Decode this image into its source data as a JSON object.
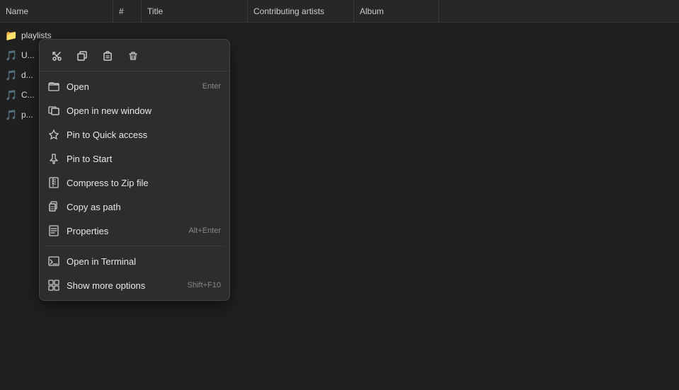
{
  "header": {
    "columns": [
      {
        "label": "Name",
        "class": "name"
      },
      {
        "label": "#",
        "class": "hash"
      },
      {
        "label": "Title",
        "class": "title"
      },
      {
        "label": "Contributing artists",
        "class": "contributing"
      },
      {
        "label": "Album",
        "class": "album"
      }
    ]
  },
  "file_list": [
    {
      "name": "playlists",
      "type": "folder"
    },
    {
      "name": "U...",
      "type": "file"
    },
    {
      "name": "d...",
      "type": "file"
    },
    {
      "name": "C...",
      "type": "file"
    },
    {
      "name": "p...",
      "type": "file"
    }
  ],
  "toolbar": {
    "cut_label": "✂",
    "copy_label": "⧉",
    "paste_label": "⬚",
    "delete_label": "🗑"
  },
  "context_menu": {
    "items": [
      {
        "id": "open",
        "label": "Open",
        "shortcut": "Enter",
        "icon": "📁"
      },
      {
        "id": "open-new-window",
        "label": "Open in new window",
        "shortcut": "",
        "icon": "⧉"
      },
      {
        "id": "pin-quick-access",
        "label": "Pin to Quick access",
        "shortcut": "",
        "icon": "☆"
      },
      {
        "id": "pin-start",
        "label": "Pin to Start",
        "shortcut": "",
        "icon": "📌"
      },
      {
        "id": "compress-zip",
        "label": "Compress to Zip file",
        "shortcut": "",
        "icon": "🗜"
      },
      {
        "id": "copy-path",
        "label": "Copy as path",
        "shortcut": "",
        "icon": "📋"
      },
      {
        "id": "properties",
        "label": "Properties",
        "shortcut": "Alt+Enter",
        "icon": "ℹ"
      },
      {
        "id": "open-terminal",
        "label": "Open in Terminal",
        "shortcut": "",
        "icon": "⊡"
      },
      {
        "id": "show-more",
        "label": "Show more options",
        "shortcut": "Shift+F10",
        "icon": "⊞"
      }
    ]
  }
}
